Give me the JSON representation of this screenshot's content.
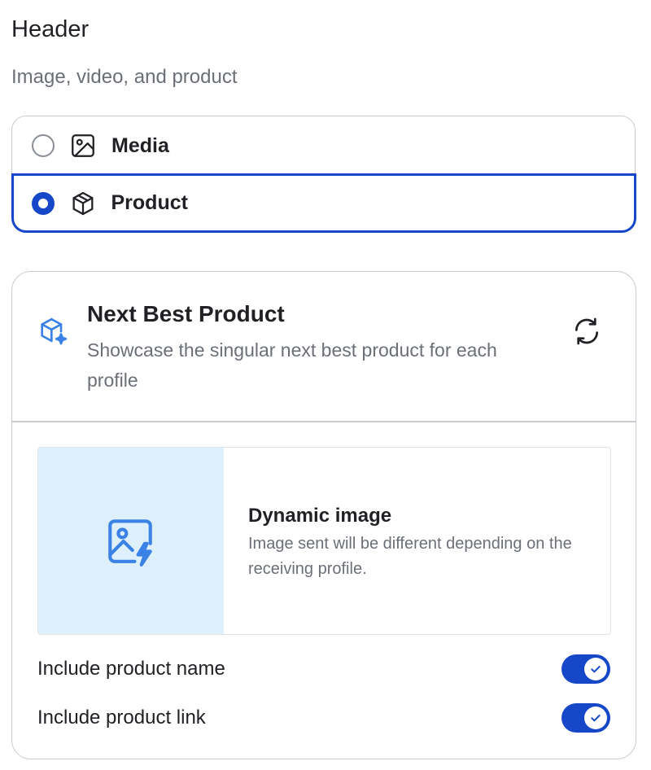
{
  "header": {
    "title": "Header",
    "subtitle": "Image, video, and product"
  },
  "options": [
    {
      "label": "Media",
      "icon": "image-icon",
      "selected": false
    },
    {
      "label": "Product",
      "icon": "box-icon",
      "selected": true
    }
  ],
  "card": {
    "icon": "box-sparkle-icon",
    "title": "Next Best Product",
    "description": "Showcase the singular next best product for each profile",
    "refresh_icon": "refresh-icon",
    "dynamic_image": {
      "icon": "image-bolt-icon",
      "title": "Dynamic image",
      "description": "Image sent will be different depending on the receiving profile."
    },
    "toggles": [
      {
        "label": "Include product name",
        "on": true
      },
      {
        "label": "Include product link",
        "on": true
      }
    ]
  },
  "colors": {
    "accent": "#1547c8",
    "preview_bg": "#dff0fd",
    "icon_blue": "#3b82e6"
  }
}
